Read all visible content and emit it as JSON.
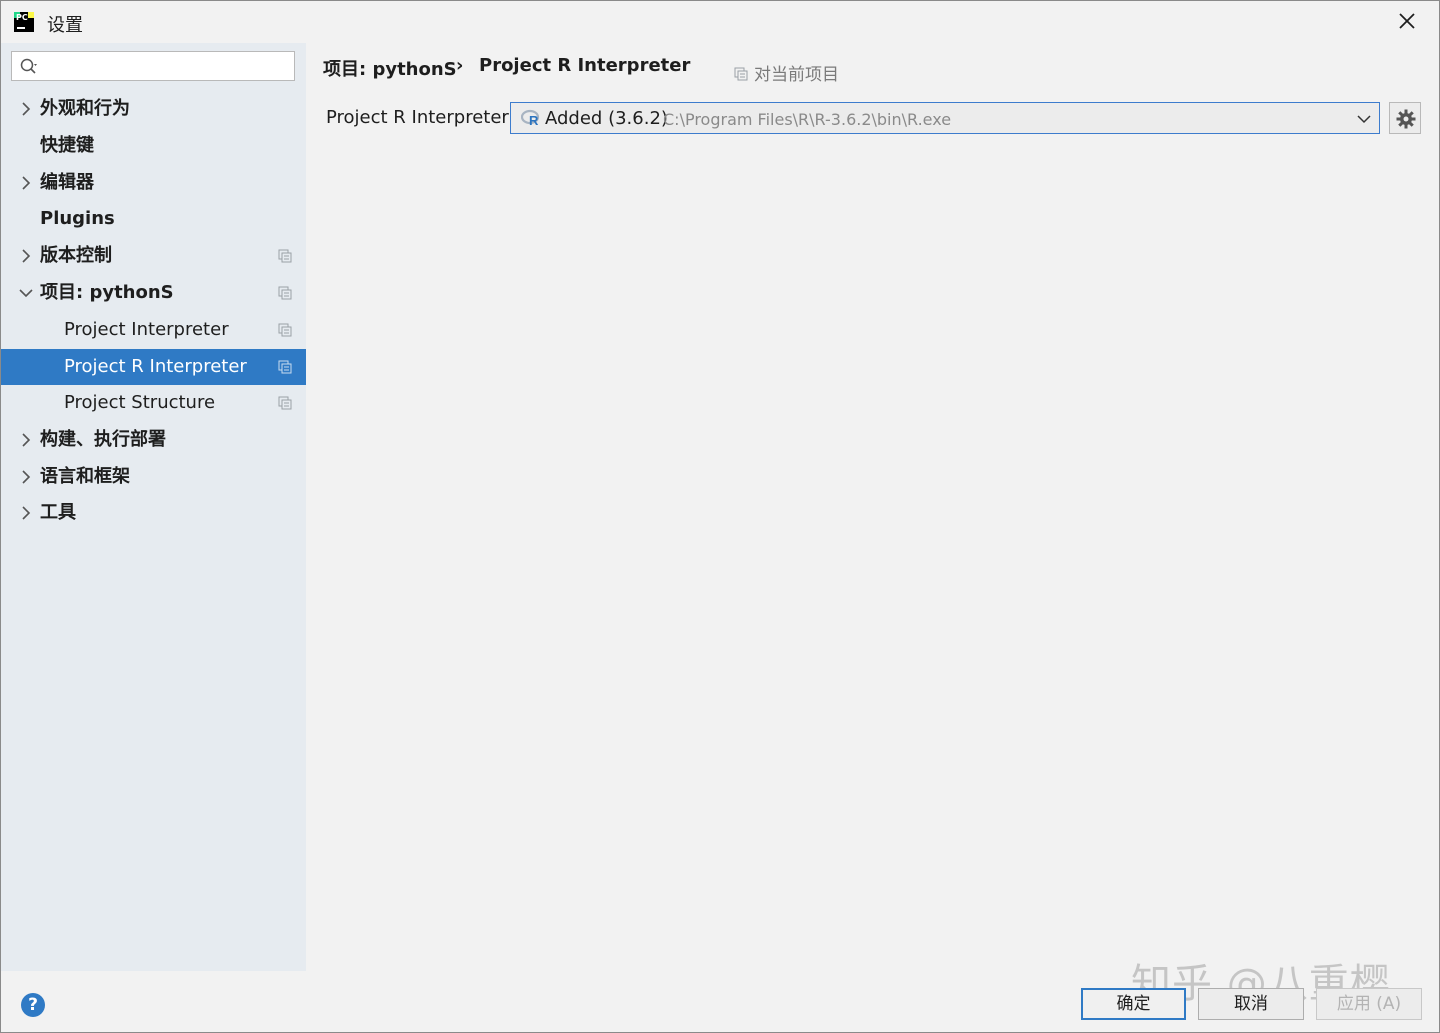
{
  "window": {
    "title": "设置"
  },
  "sidebar": {
    "search": {
      "value": "",
      "placeholder": ""
    },
    "items": [
      {
        "label": "外观和行为",
        "expandable": true,
        "expanded": false
      },
      {
        "label": "快捷键",
        "expandable": false
      },
      {
        "label": "编辑器",
        "expandable": true,
        "expanded": false
      },
      {
        "label": "Plugins",
        "expandable": false
      },
      {
        "label": "版本控制",
        "expandable": true,
        "expanded": false,
        "project_scope_icon": true
      },
      {
        "label": "项目: pythonS",
        "expandable": true,
        "expanded": true,
        "project_scope_icon": true
      },
      {
        "label": "Project Interpreter",
        "child": true,
        "project_scope_icon": true
      },
      {
        "label": "Project R Interpreter",
        "child": true,
        "selected": true,
        "project_scope_icon": true
      },
      {
        "label": "Project Structure",
        "child": true,
        "project_scope_icon": true
      },
      {
        "label": "构建、执行部署",
        "expandable": true,
        "expanded": false
      },
      {
        "label": "语言和框架",
        "expandable": true,
        "expanded": false
      },
      {
        "label": "工具",
        "expandable": true,
        "expanded": false
      }
    ]
  },
  "main": {
    "breadcrumb": [
      "项目: pythonS",
      "Project R Interpreter"
    ],
    "breadcrumb_separator": "›",
    "scope_note": "对当前项目",
    "interpreter_label": "Project R Interpreter:",
    "interpreter": {
      "name": "Added (3.6.2)",
      "path": "C:\\Program Files\\R\\R-3.6.2\\bin\\R.exe"
    }
  },
  "footer": {
    "help_label": "?",
    "ok_label": "确定",
    "cancel_label": "取消",
    "apply_label": "应用 (A)"
  },
  "watermark": "知乎 @八重樱",
  "colors": {
    "accent": "#2f7ac5",
    "sidebar_bg": "#e6ebf0",
    "content_bg": "#f2f2f2",
    "disabled_text": "#b3b3b3"
  },
  "icons": [
    "pycharm-app-icon",
    "close-icon",
    "search-icon",
    "chevron-right-icon",
    "chevron-down-icon",
    "project-scope-icon",
    "r-language-icon",
    "dropdown-chevron-icon",
    "gear-icon",
    "help-icon"
  ]
}
